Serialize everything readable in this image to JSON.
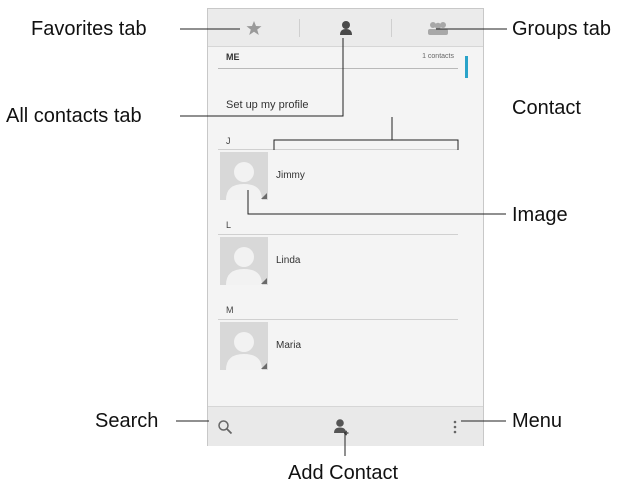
{
  "callouts": {
    "favorites_tab": "Favorites tab",
    "groups_tab": "Groups tab",
    "all_contacts_tab": "All contacts tab",
    "contact": "Contact",
    "image": "Image",
    "search": "Search",
    "menu": "Menu",
    "add_contact": "Add Contact"
  },
  "tabs": {
    "favorites_icon": "star-icon",
    "all_contacts_icon": "person-icon",
    "groups_icon": "group-icon"
  },
  "list": {
    "me_label": "ME",
    "me_count": "1 contacts",
    "profile_label": "Set up my profile",
    "sections": [
      {
        "letter": "J",
        "name": "Jimmy"
      },
      {
        "letter": "L",
        "name": "Linda"
      },
      {
        "letter": "M",
        "name": "Maria"
      }
    ]
  },
  "bottom_bar": {
    "search_icon": "search-icon",
    "add_contact_icon": "add-person-icon",
    "menu_icon": "overflow-menu-icon"
  },
  "colors": {
    "accent": "#2aa3c9",
    "background": "#f4f4f4",
    "bar": "#ebebeb"
  }
}
